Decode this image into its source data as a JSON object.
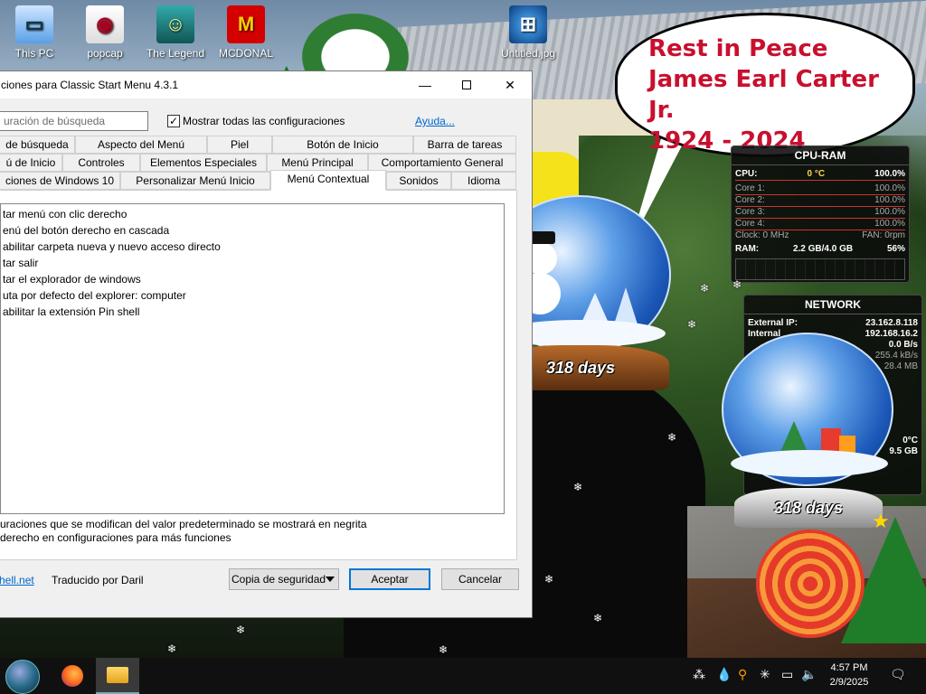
{
  "desktop": {
    "icons": [
      {
        "label": "This PC"
      },
      {
        "label": "popcap"
      },
      {
        "label": "The Legend"
      },
      {
        "label": "MCDONAL"
      },
      {
        "label": "Untitled.jpg"
      }
    ]
  },
  "bubble": {
    "line1": "Rest in Peace",
    "line2": "James Earl Carter Jr.",
    "line3": "1924 - 2024"
  },
  "cpu_gadget": {
    "title": "CPU-RAM",
    "cpu_label": "CPU:",
    "cpu_temp": "0 °C",
    "cpu_pct": "100.0%",
    "cores": [
      {
        "label": "Core 1:",
        "value": "100.0%"
      },
      {
        "label": "Core 2:",
        "value": "100.0%"
      },
      {
        "label": "Core 3:",
        "value": "100.0%"
      },
      {
        "label": "Core 4:",
        "value": "100.0%"
      }
    ],
    "clock": "Clock: 0 MHz",
    "fan": "FAN: 0rpm",
    "ram_label": "RAM:",
    "ram_value": "2.2 GB/4.0 GB",
    "ram_pct": "56%"
  },
  "net_gadget": {
    "title": "NETWORK",
    "external_label": "External IP:",
    "external_value": "23.162.8.118",
    "internal_label": "Internal",
    "internal_value": "192.168.16.2",
    "speed1": "0.0 B/s",
    "speed2": "255.4 kB/s",
    "speed3": "28.4 MB",
    "temp": "0°C",
    "size": "9.5 GB"
  },
  "globes": {
    "big": "318 days",
    "small": "318 days"
  },
  "dialog": {
    "title": "ciones para Classic Start Menu 4.3.1",
    "search_placeholder": "uración de búsqueda",
    "show_all_check": "✓",
    "show_all_label": "Mostrar todas las configuraciones",
    "help_link": "Ayuda...",
    "tabs_row1": [
      "de búsqueda",
      "Aspecto del Menú",
      "Piel",
      "Botón de Inicio",
      "Barra de tareas"
    ],
    "tabs_row2": [
      "ú de Inicio",
      "Controles",
      "Elementos Especiales",
      "Menú Principal",
      "Comportamiento General"
    ],
    "tabs_row3": [
      "ciones de Windows 10",
      "Personalizar Menú Inicio",
      "Menú Contextual",
      "Sonidos",
      "Idioma"
    ],
    "items": [
      "tar menú con clic derecho",
      "enú del botón derecho en cascada",
      "abilitar carpeta nueva y nuevo acceso directo",
      "tar salir",
      "tar el explorador de windows",
      "uta por defecto del explorer: computer",
      "abilitar la extensión Pin shell"
    ],
    "note1": "uraciones que se modifican del valor predeterminado se mostrará en negrita",
    "note2": "derecho en configuraciones para más funciones",
    "footer_link": "hell.net",
    "footer_text": "Traducido por Daril",
    "backup_button": "Copia de seguridad",
    "ok_button": "Aceptar",
    "cancel_button": "Cancelar"
  },
  "taskbar": {
    "time": "4:57 PM",
    "date": "2/9/2025"
  }
}
